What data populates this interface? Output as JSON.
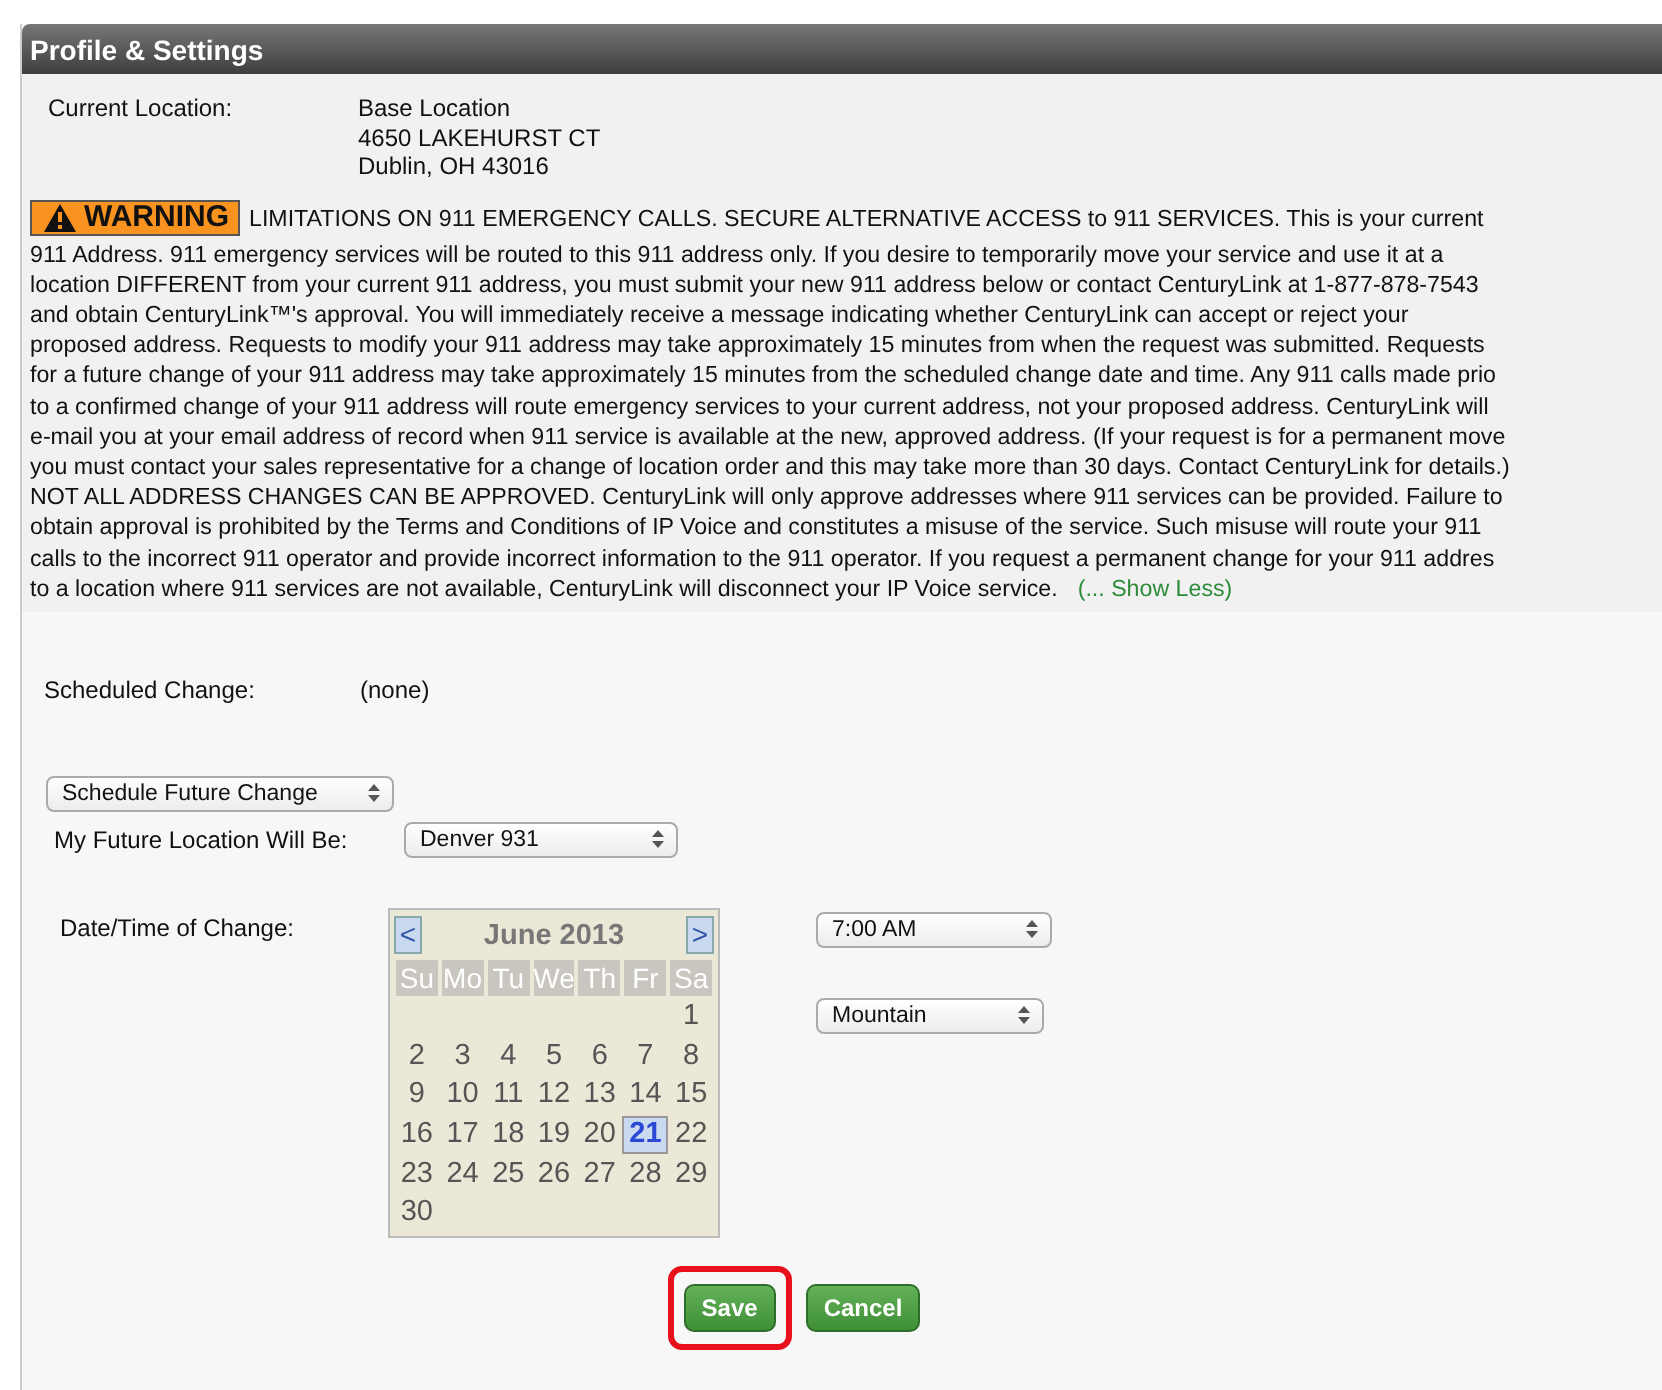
{
  "panel": {
    "title": "Profile & Settings"
  },
  "current_location": {
    "label": "Current Location:",
    "lines": [
      "Base Location",
      "4650 LAKEHURST CT",
      "Dublin, OH 43016"
    ]
  },
  "warning": {
    "badge": "WARNING",
    "lines": [
      "LIMITATIONS ON 911 EMERGENCY CALLS. SECURE ALTERNATIVE ACCESS to 911 SERVICES. This is your current",
      "911 Address. 911 emergency services will be routed to this 911 address only. If you desire to temporarily move your service and use it at a",
      "location DIFFERENT from your current 911 address, you must submit your new 911 address below or contact CenturyLink at 1-877-878-7543",
      "and obtain CenturyLink™'s approval. You will immediately receive a message indicating whether CenturyLink can accept or reject your",
      "proposed address. Requests to modify your 911 address may take approximately 15 minutes from when the request was submitted. Requests",
      "for a future change of your 911 address may take approximately 15 minutes from the scheduled change date and time. Any 911 calls made prio",
      "to a confirmed change of your 911 address will route emergency services to your current address, not your proposed address. CenturyLink will",
      "e-mail you at your email address of record when 911 service is available at the new, approved address. (If your request is for a permanent move",
      "you must contact your sales representative for a change of location order and this may take more than 30 days. Contact CenturyLink for details.)",
      "NOT ALL ADDRESS CHANGES CAN BE APPROVED. CenturyLink will only approve addresses where 911 services can be provided. Failure to",
      "obtain approval is prohibited by the Terms and Conditions of IP Voice and constitutes a misuse of the service. Such misuse will route your 911",
      "calls to the incorrect 911 operator and provide incorrect information to the 911 operator. If you request a permanent change for your 911 addres",
      "to a location where 911 services are not available, CenturyLink will disconnect your IP Voice service."
    ],
    "link": "(... Show Less)"
  },
  "scheduled_change": {
    "label": "Scheduled Change:",
    "value": "(none)"
  },
  "action_select": {
    "value": "Schedule Future Change"
  },
  "future_location": {
    "label": "My Future Location Will Be:",
    "value": "Denver 931"
  },
  "date_time": {
    "label": "Date/Time of Change:",
    "time": "7:00 AM",
    "timezone": "Mountain"
  },
  "calendar": {
    "prev": "<",
    "next": ">",
    "month": "June 2013",
    "weekdays": [
      "Su",
      "Mo",
      "Tu",
      "We",
      "Th",
      "Fr",
      "Sa"
    ],
    "weeks": [
      {
        "days": [
          {
            "label": "1",
            "selected": false
          }
        ]
      },
      {
        "days": [
          {
            "label": "2",
            "selected": false
          },
          {
            "label": "3",
            "selected": false
          },
          {
            "label": "4",
            "selected": false
          },
          {
            "label": "5",
            "selected": false
          },
          {
            "label": "6",
            "selected": false
          },
          {
            "label": "7",
            "selected": false
          },
          {
            "label": "8",
            "selected": false
          }
        ]
      },
      {
        "days": [
          {
            "label": "9",
            "selected": false
          },
          {
            "label": "10",
            "selected": false
          },
          {
            "label": "11",
            "selected": false
          },
          {
            "label": "12",
            "selected": false
          },
          {
            "label": "13",
            "selected": false
          },
          {
            "label": "14",
            "selected": false
          },
          {
            "label": "15",
            "selected": false
          }
        ]
      },
      {
        "days": [
          {
            "label": "16",
            "selected": false
          },
          {
            "label": "17",
            "selected": false
          },
          {
            "label": "18",
            "selected": false
          },
          {
            "label": "19",
            "selected": false
          },
          {
            "label": "20",
            "selected": false
          },
          {
            "label": "21",
            "selected": true
          },
          {
            "label": "22",
            "selected": false
          }
        ]
      },
      {
        "days": [
          {
            "label": "23",
            "selected": false
          },
          {
            "label": "24",
            "selected": false
          },
          {
            "label": "25",
            "selected": false
          },
          {
            "label": "26",
            "selected": false
          },
          {
            "label": "27",
            "selected": false
          },
          {
            "label": "28",
            "selected": false
          },
          {
            "label": "29",
            "selected": false
          }
        ]
      },
      {
        "days": [
          {
            "label": "30",
            "selected": false
          }
        ]
      }
    ]
  },
  "buttons": [
    {
      "label": "Save",
      "highlighted": true
    },
    {
      "label": "Cancel",
      "highlighted": false
    }
  ]
}
